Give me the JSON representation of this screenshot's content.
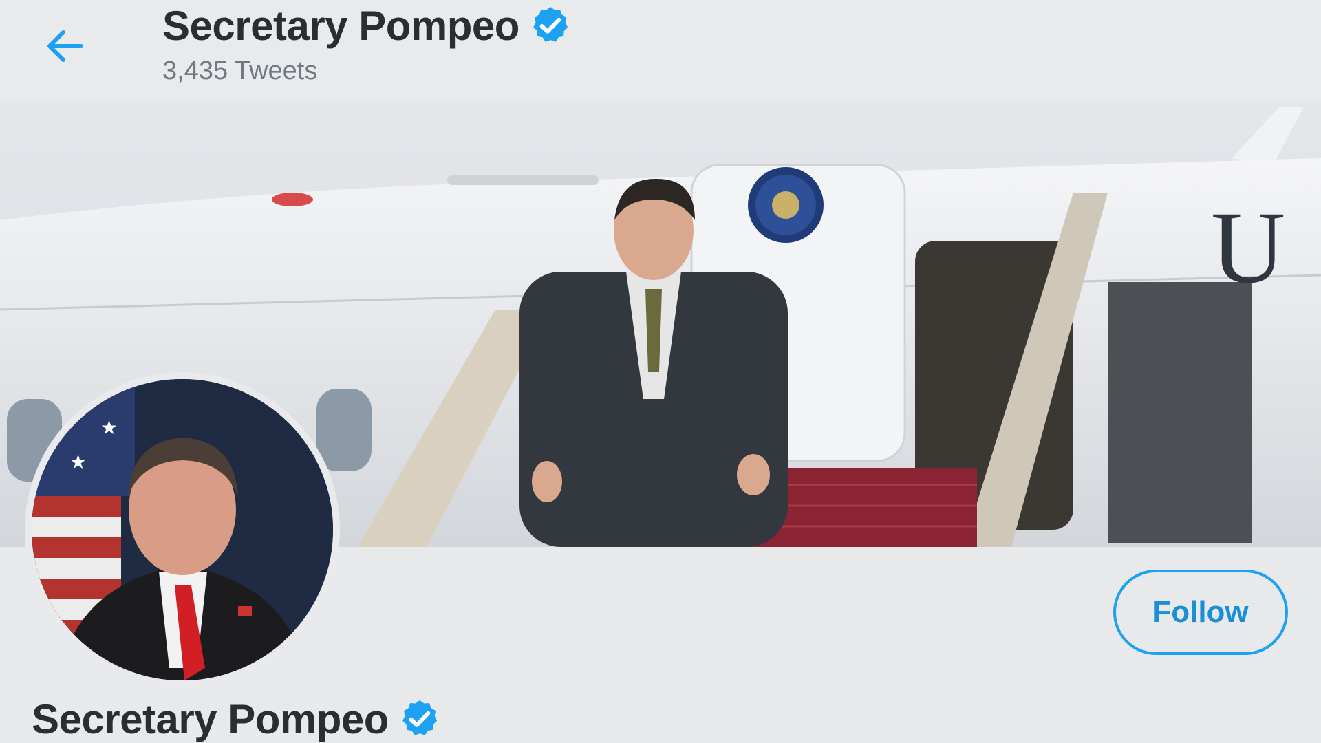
{
  "header": {
    "name": "Secretary Pompeo",
    "tweet_count": "3,435 Tweets",
    "back_icon": "arrow-left-icon",
    "verified_icon": "verified-badge-icon"
  },
  "banner": {
    "description_icon": "banner-photo"
  },
  "profile": {
    "name": "Secretary Pompeo",
    "follow_label": "Follow",
    "verified_icon": "verified-badge-icon"
  },
  "colors": {
    "accent": "#1da1f2",
    "text": "#2b2e31",
    "muted": "#6f7a84",
    "background": "#e8e9eb"
  }
}
